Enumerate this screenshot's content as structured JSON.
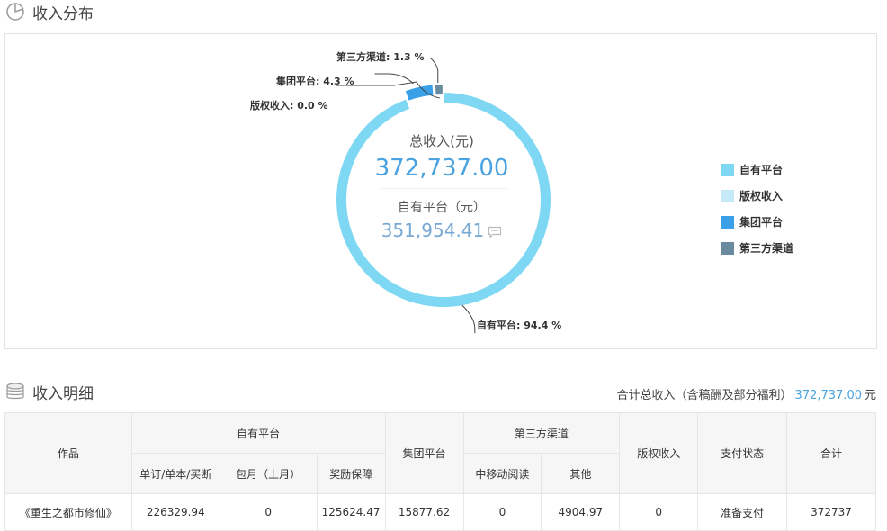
{
  "distribution": {
    "title": "收入分布",
    "center": {
      "total_label": "总收入(元)",
      "total_value": "372,737.00",
      "own_label": "自有平台（元）",
      "own_value": "351,954.41"
    }
  },
  "chart_data": {
    "type": "pie",
    "series": [
      {
        "name": "自有平台",
        "value": 94.4,
        "color": "#7fd8f3",
        "callout": "自有平台: 94.4 %"
      },
      {
        "name": "版权收入",
        "value": 0.0,
        "color": "#c5e9f6",
        "callout": "版权收入: 0.0 %"
      },
      {
        "name": "集团平台",
        "value": 4.3,
        "color": "#3aa0e8",
        "callout": "集团平台: 4.3 %"
      },
      {
        "name": "第三方渠道",
        "value": 1.3,
        "color": "#6a8aa0",
        "callout": "第三方渠道: 1.3 %"
      }
    ],
    "legend": "right"
  },
  "detail": {
    "title": "收入明细",
    "summary_label": "合计总收入（含稿酬及部分福利）",
    "summary_amount": "372,737.00",
    "summary_unit": "元",
    "headers": {
      "work": "作品",
      "own_platform": "自有平台",
      "own_sub": [
        "单订/单本/买断",
        "包月（上月）",
        "奖励保障"
      ],
      "group_platform": "集团平台",
      "third_party": "第三方渠道",
      "third_sub": [
        "中移动阅读",
        "其他"
      ],
      "copyright": "版权收入",
      "pay_status": "支付状态",
      "total": "合计"
    },
    "rows": [
      {
        "work": "《重生之都市修仙》",
        "subscription": "226329.94",
        "monthly": "0",
        "reward": "125624.47",
        "group": "15877.62",
        "cmread": "0",
        "other": "4904.97",
        "copyright": "0",
        "status": "准备支付",
        "total": "372737"
      }
    ]
  }
}
